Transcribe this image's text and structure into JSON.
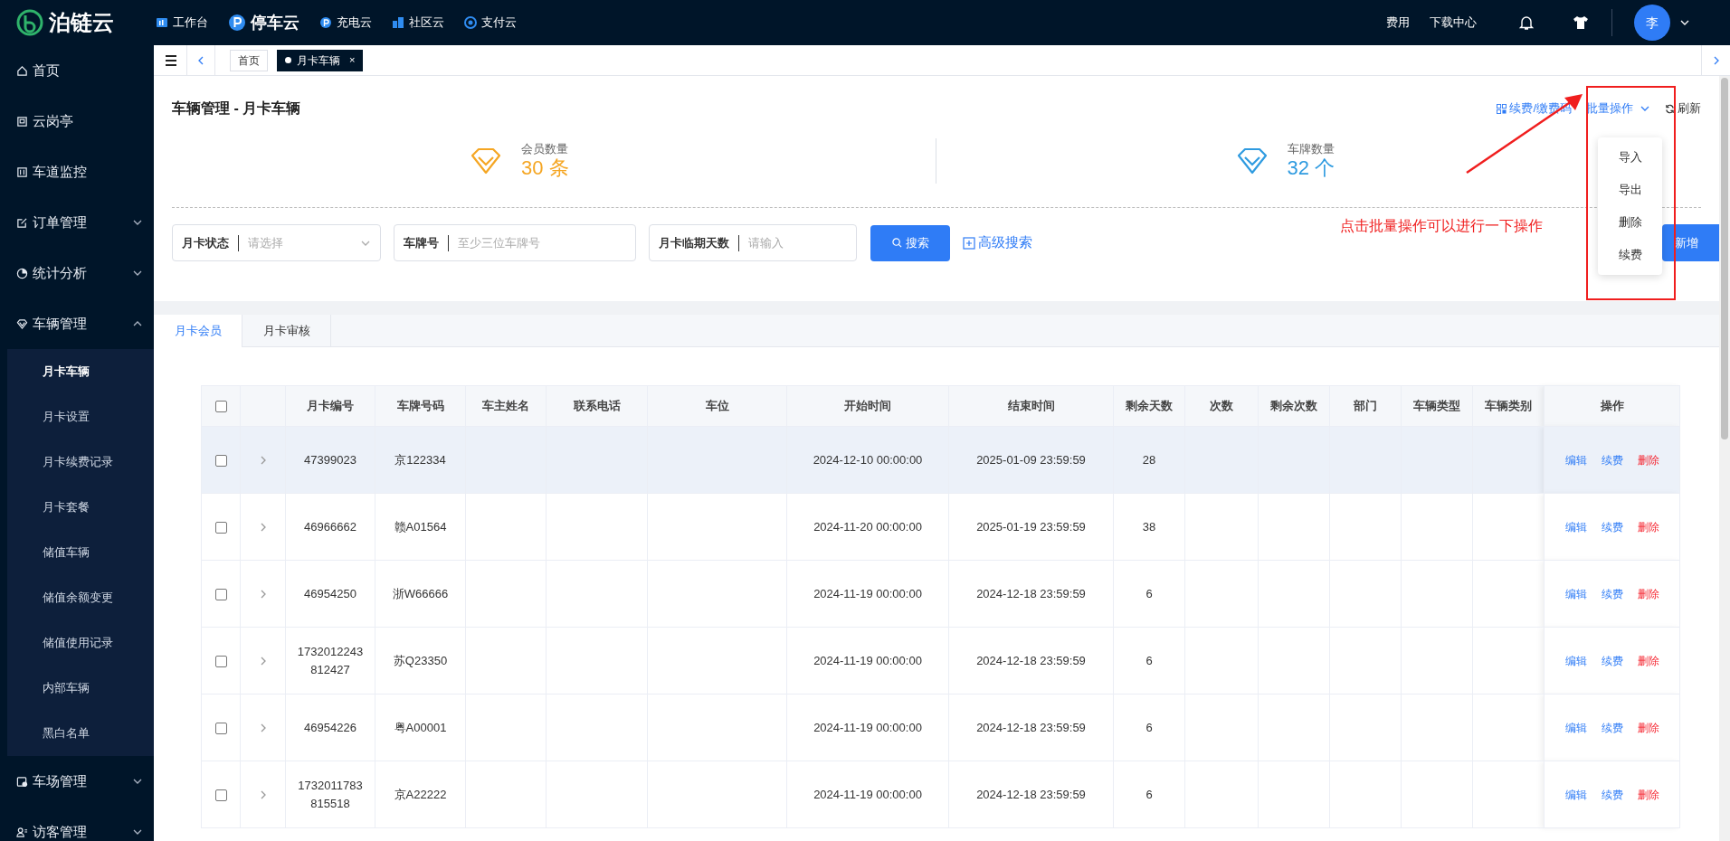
{
  "brand": {
    "name": "泊链云"
  },
  "top_nav": [
    {
      "label": "工作台",
      "selected": false
    },
    {
      "label": "停车云",
      "selected": true
    },
    {
      "label": "充电云",
      "selected": false
    },
    {
      "label": "社区云",
      "selected": false
    },
    {
      "label": "支付云",
      "selected": false
    }
  ],
  "top_right": {
    "links": [
      "费用",
      "下载中心"
    ],
    "avatar": "李"
  },
  "page_tabs": [
    {
      "label": "首页",
      "selected": false
    },
    {
      "label": "月卡车辆",
      "selected": true,
      "close": "×"
    }
  ],
  "sidebar": {
    "items": [
      {
        "label": "首页"
      },
      {
        "label": "云岗亭"
      },
      {
        "label": "车道监控"
      },
      {
        "label": "订单管理",
        "expanded": false
      },
      {
        "label": "统计分析",
        "expanded": false
      },
      {
        "label": "车辆管理",
        "expanded": true,
        "children": [
          {
            "label": "月卡车辆",
            "selected": true
          },
          {
            "label": "月卡设置",
            "selected": false
          },
          {
            "label": "月卡续费记录",
            "selected": false
          },
          {
            "label": "月卡套餐",
            "selected": false
          },
          {
            "label": "储值车辆",
            "selected": false
          },
          {
            "label": "储值余额变更",
            "selected": false
          },
          {
            "label": "储值使用记录",
            "selected": false
          },
          {
            "label": "内部车辆",
            "selected": false
          },
          {
            "label": "黑白名单",
            "selected": false
          }
        ]
      },
      {
        "label": "车场管理",
        "expanded": false
      },
      {
        "label": "访客管理",
        "expanded": false
      }
    ]
  },
  "page_title": "车辆管理 - 月卡车辆",
  "header_actions": [
    {
      "label": "续费/缴费码",
      "kind": "qr"
    },
    {
      "label": "批量操作",
      "kind": "dropdown",
      "expanded": true,
      "menu": [
        "导入",
        "导出",
        "删除",
        "续费"
      ]
    },
    {
      "label": "刷新",
      "kind": "refresh"
    }
  ],
  "stats": [
    {
      "label": "会员数量",
      "value": "30 条",
      "color": "#f5a623"
    },
    {
      "label": "车牌数量",
      "value": "32 个",
      "color": "#2f9be0"
    }
  ],
  "filters": [
    {
      "label": "月卡状态",
      "placeholder": "请选择",
      "kind": "select"
    },
    {
      "label": "车牌号",
      "placeholder": "至少三位车牌号",
      "kind": "input"
    },
    {
      "label": "月卡临期天数",
      "placeholder": "请输入",
      "kind": "input"
    }
  ],
  "search_button": "搜索",
  "advanced_search": "高级搜索",
  "add_button": "新增",
  "annotation": {
    "text": "点击批量操作可以进行一下操作"
  },
  "content_tabs": [
    {
      "label": "月卡会员",
      "selected": true
    },
    {
      "label": "月卡审核",
      "selected": false
    }
  ],
  "table": {
    "select_all": {
      "checked": false
    },
    "columns": [
      "月卡编号",
      "车牌号码",
      "车主姓名",
      "联系电话",
      "车位",
      "开始时间",
      "结束时间",
      "剩余天数",
      "次数",
      "剩余次数",
      "部门",
      "车辆类型",
      "车辆类别",
      "操作"
    ],
    "rows": [
      {
        "checked": false,
        "selected": true,
        "expanded": false,
        "card_no": "47399023",
        "plate": "京122334",
        "start": "2024-12-10 00:00:00",
        "end": "2025-01-09 23:59:59",
        "days_left": "28",
        "actions": [
          {
            "label": "编辑",
            "kind": "edit"
          },
          {
            "label": "续费",
            "kind": "renew"
          },
          {
            "label": "删除",
            "kind": "delete"
          }
        ]
      },
      {
        "checked": false,
        "selected": false,
        "expanded": false,
        "card_no": "46966662",
        "plate": "赣A01564",
        "start": "2024-11-20 00:00:00",
        "end": "2025-01-19 23:59:59",
        "days_left": "38",
        "actions": [
          {
            "label": "编辑",
            "kind": "edit"
          },
          {
            "label": "续费",
            "kind": "renew"
          },
          {
            "label": "删除",
            "kind": "delete"
          }
        ]
      },
      {
        "checked": false,
        "selected": false,
        "expanded": false,
        "card_no": "46954250",
        "plate": "浙W66666",
        "start": "2024-11-19 00:00:00",
        "end": "2024-12-18 23:59:59",
        "days_left": "6",
        "actions": [
          {
            "label": "编辑",
            "kind": "edit"
          },
          {
            "label": "续费",
            "kind": "renew"
          },
          {
            "label": "删除",
            "kind": "delete"
          }
        ]
      },
      {
        "checked": false,
        "selected": false,
        "expanded": false,
        "card_no": "1732012243812427",
        "plate": "苏Q23350",
        "start": "2024-11-19 00:00:00",
        "end": "2024-12-18 23:59:59",
        "days_left": "6",
        "actions": [
          {
            "label": "编辑",
            "kind": "edit"
          },
          {
            "label": "续费",
            "kind": "renew"
          },
          {
            "label": "删除",
            "kind": "delete"
          }
        ]
      },
      {
        "checked": false,
        "selected": false,
        "expanded": false,
        "card_no": "46954226",
        "plate": "粤A00001",
        "start": "2024-11-19 00:00:00",
        "end": "2024-12-18 23:59:59",
        "days_left": "6",
        "actions": [
          {
            "label": "编辑",
            "kind": "edit"
          },
          {
            "label": "续费",
            "kind": "renew"
          },
          {
            "label": "删除",
            "kind": "delete"
          }
        ]
      },
      {
        "checked": false,
        "selected": false,
        "expanded": false,
        "card_no": "1732011783815518",
        "plate": "京A22222",
        "start": "2024-11-19 00:00:00",
        "end": "2024-12-18 23:59:59",
        "days_left": "6",
        "actions": [
          {
            "label": "编辑",
            "kind": "edit"
          },
          {
            "label": "续费",
            "kind": "renew"
          },
          {
            "label": "删除",
            "kind": "delete"
          }
        ]
      }
    ]
  }
}
